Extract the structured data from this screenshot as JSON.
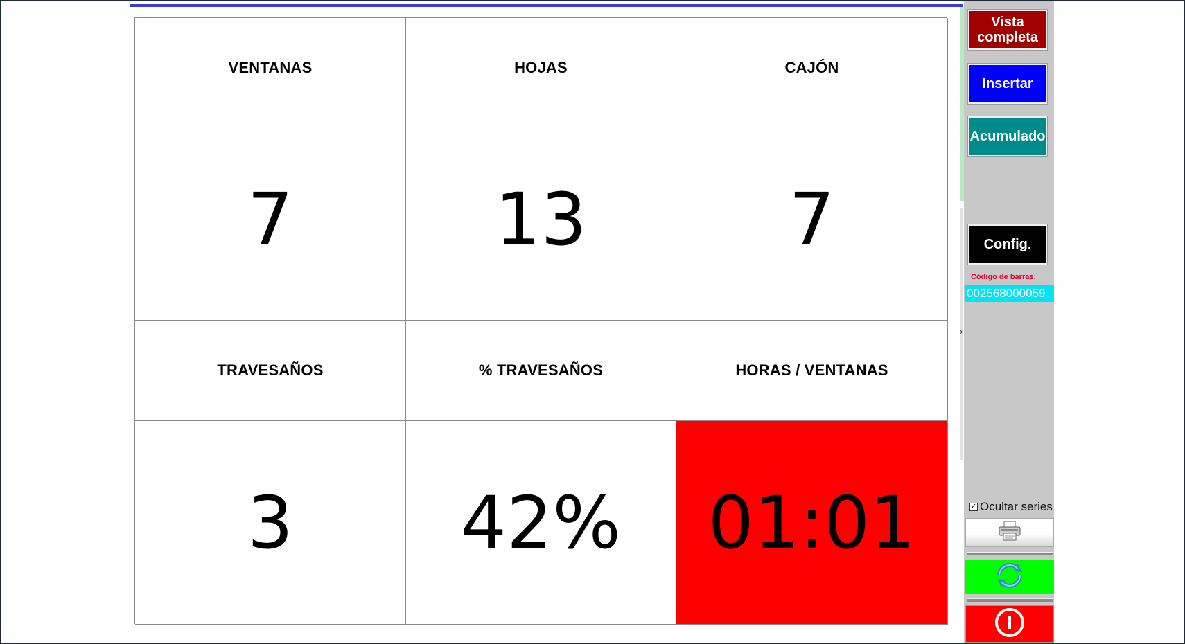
{
  "grid": {
    "row1_headers": [
      "VENTANAS",
      "HOJAS",
      "CAJÓN"
    ],
    "row1_values": [
      "7",
      "13",
      "7"
    ],
    "row2_headers": [
      "TRAVESAÑOS",
      "% TRAVESAÑOS",
      "HORAS / VENTANAS"
    ],
    "row2_values": [
      "3",
      "42%",
      "01:01"
    ],
    "alert_color": "#ff0000"
  },
  "panel": {
    "vista_completa": "Vista completa",
    "insertar": "Insertar",
    "acumulado": "Acumulado",
    "config": "Config.",
    "barcode_label": "Código de barras:",
    "barcode_value": "002568000059",
    "ocultar_series": "Ocultar series",
    "ocultar_series_checked": true,
    "print_icon": "printer-icon",
    "refresh_icon": "refresh-icon",
    "power_icon": "power-icon",
    "colors": {
      "vista": "#a00000",
      "insertar": "#0000ff",
      "acumulado": "#008b8b",
      "config": "#000000",
      "refresh": "#00ff00",
      "power": "#ff0000",
      "barcode_field": "#00e5f0"
    }
  }
}
